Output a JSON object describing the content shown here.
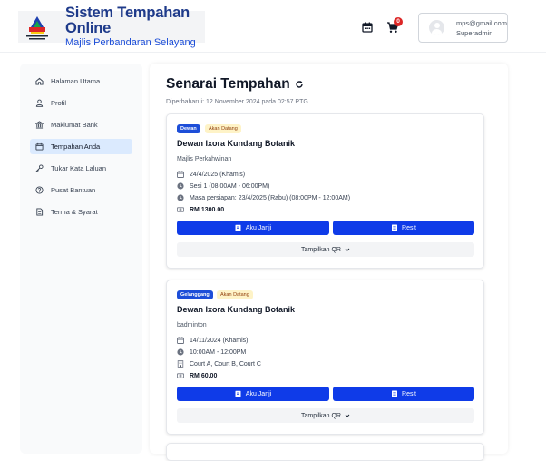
{
  "header": {
    "app_title": "Sistem Tempahan Online",
    "app_subtitle": "Majlis Perbandaran Selayang",
    "cart_count": "0",
    "user_email": "mps@gmail.com",
    "user_role": "Superadmin",
    "brand_color": "#1e3a8a"
  },
  "sidebar": {
    "items": [
      {
        "label": "Halaman Utama",
        "icon": "home-icon"
      },
      {
        "label": "Profil",
        "icon": "user-icon"
      },
      {
        "label": "Maklumat Bank",
        "icon": "bank-icon"
      },
      {
        "label": "Tempahan Anda",
        "icon": "calendar-icon",
        "active": true
      },
      {
        "label": "Tukar Kata Laluan",
        "icon": "key-icon"
      },
      {
        "label": "Pusat Bantuan",
        "icon": "help-icon"
      },
      {
        "label": "Terma & Syarat",
        "icon": "document-icon"
      }
    ]
  },
  "main": {
    "title": "Senarai Tempahan",
    "updated": "Diperbaharui: 12 November 2024 pada 02:57 PTG"
  },
  "bookings": [
    {
      "type": "Dewan",
      "status": "Akan Datang",
      "venue": "Dewan Ixora Kundang Botanik",
      "purpose": "Majlis Perkahwinan",
      "date": "24/4/2025 (Khamis)",
      "session": "Sesi 1 (08:00AM - 06:00PM)",
      "prep": "Masa persiapan: 23/4/2025 (Rabu) (08:00PM - 12:00AM)",
      "price": "RM 1300.00",
      "btn_pledge": "Aku Janji",
      "btn_receipt": "Resit",
      "btn_qr": "Tampilkan QR"
    },
    {
      "type": "Gelanggang",
      "status": "Akan Datang",
      "venue": "Dewan Ixora Kundang Botanik",
      "purpose": "badminton",
      "date": "14/11/2024 (Khamis)",
      "time": "10:00AM - 12:00PM",
      "courts": "Court A, Court B, Court C",
      "price": "RM 60.00",
      "btn_pledge": "Aku Janji",
      "btn_receipt": "Resit",
      "btn_qr": "Tampilkan QR"
    }
  ]
}
